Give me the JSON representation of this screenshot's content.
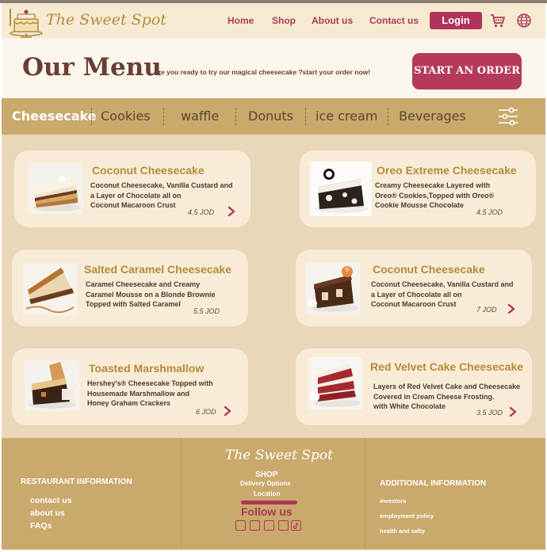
{
  "nav": {
    "brand": "The Sweet Spot",
    "links": [
      "Home",
      "Shop",
      "About us",
      "Contact us"
    ],
    "login_label": "Login",
    "cart_icon": "cart-icon",
    "language_icon": "globe-icon"
  },
  "hero": {
    "title": "Our Menu",
    "subtitle": "are you ready to try our magical cheesecake ?start your order now!",
    "cta_label": "START AN ORDER"
  },
  "categories": {
    "items": [
      "Cheesecake",
      "Cookies",
      "waffle",
      "Donuts",
      "ice cream",
      "Beverages"
    ],
    "active": "Cheesecake",
    "filter_icon": "sliders-icon"
  },
  "menu_items": [
    {
      "name": "Coconut Cheesecake",
      "desc": [
        "Coconut Cheesecake, Vanilla Custard and",
        "a Layer of Chocolate all on",
        "Coconut Macaroon Crust"
      ],
      "price": "4.5 JOD"
    },
    {
      "name": "Oreo Extreme Cheesecake",
      "desc": [
        "Creamy Cheesecake Layered with",
        "Oreo® Cookies,Topped with Oreo®",
        "Cookie Mousse Chocolate"
      ],
      "price": "4.5 JOD"
    },
    {
      "name": "Salted Caramel Cheesecake",
      "desc": [
        "Caramel Cheesecake and Creamy",
        " Caramel Mousse on a Blonde Brownie",
        " Topped with Salted Caramel"
      ],
      "price": "5.5 JOD"
    },
    {
      "name": "Coconut Cheesecake",
      "desc": [
        "Coconut Cheesecake, Vanilla Custard and",
        "a Layer of Chocolate all on",
        "Coconut Macaroon Crust"
      ],
      "price": "7 JOD"
    },
    {
      "name": "Toasted Marshmallow",
      "desc": [
        "Hershey's® Cheesecake Topped with",
        "Housemade Marshmallow and",
        "Honey Graham Crackers"
      ],
      "price": "6 JOD"
    },
    {
      "name": "Red Velvet Cake Cheesecake",
      "desc": [
        "Layers of Red Velvet Cake and Cheesecake",
        "  Covered in Cream Cheese Frosting.",
        " with White Chocolate"
      ],
      "price": "3.5 JOD"
    }
  ],
  "footer": {
    "brand": "The Sweet Spot",
    "restaurant_info": {
      "heading": "RESTAURANT INFORMATION",
      "links": [
        "contact us",
        "about us",
        "FAQs"
      ]
    },
    "shop": {
      "heading": "SHOP",
      "links": [
        "Delivery Options",
        "Location"
      ]
    },
    "follow_label": "Follow us",
    "social_icons": [
      "facebook-icon",
      "instagram-icon",
      "twitter-icon",
      "youtube-icon",
      "tiktok-icon"
    ],
    "additional_info": {
      "heading": "ADDITIONAL INFORMATION",
      "links": [
        "investors",
        "employment policy",
        "health and safty"
      ]
    }
  }
}
